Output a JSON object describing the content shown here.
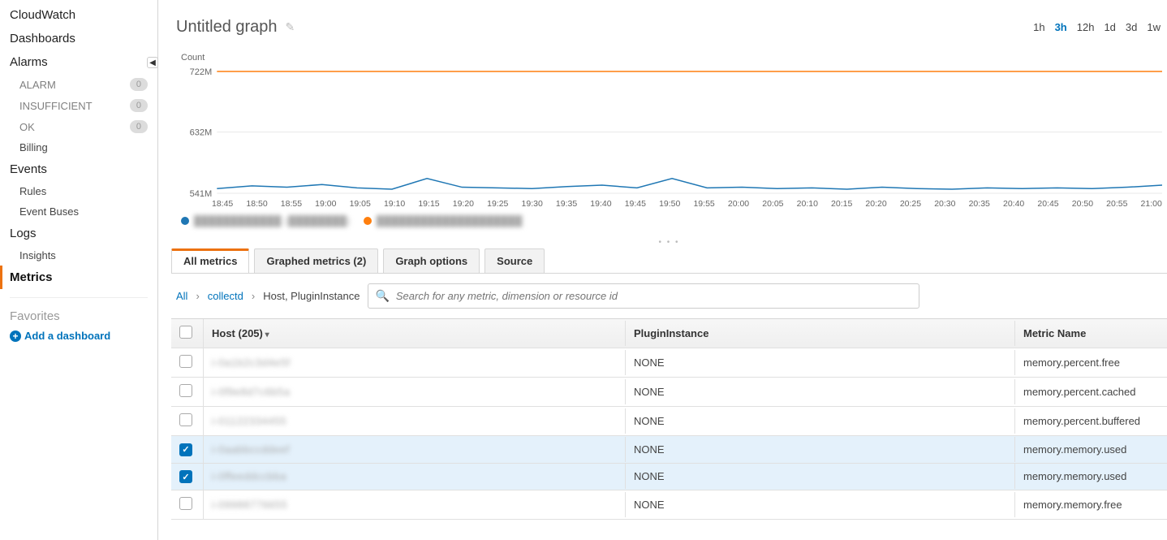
{
  "sidebar": {
    "items": [
      {
        "label": "CloudWatch",
        "type": "top"
      },
      {
        "label": "Dashboards",
        "type": "top"
      },
      {
        "label": "Alarms",
        "type": "top"
      },
      {
        "label": "ALARM",
        "type": "sub",
        "badge": "0",
        "muted": true
      },
      {
        "label": "INSUFFICIENT",
        "type": "sub",
        "badge": "0",
        "muted": true
      },
      {
        "label": "OK",
        "type": "sub",
        "badge": "0",
        "muted": true
      },
      {
        "label": "Billing",
        "type": "sub",
        "normal": true
      },
      {
        "label": "Events",
        "type": "top"
      },
      {
        "label": "Rules",
        "type": "sub",
        "normal": true
      },
      {
        "label": "Event Buses",
        "type": "sub",
        "normal": true
      },
      {
        "label": "Logs",
        "type": "top"
      },
      {
        "label": "Insights",
        "type": "sub",
        "normal": true
      },
      {
        "label": "Metrics",
        "type": "top",
        "active": true
      }
    ],
    "favorites_title": "Favorites",
    "add_dashboard": "Add a dashboard"
  },
  "header": {
    "title": "Untitled graph",
    "time_ranges": [
      "1h",
      "3h",
      "12h",
      "1d",
      "3d",
      "1w"
    ],
    "active_range": "3h"
  },
  "chart_data": {
    "type": "line",
    "title": "Count",
    "ylabel": "Count",
    "y_ticks": [
      "722M",
      "632M",
      "541M"
    ],
    "ylim": [
      541,
      722
    ],
    "x_ticks": [
      "18:45",
      "18:50",
      "18:55",
      "19:00",
      "19:05",
      "19:10",
      "19:15",
      "19:20",
      "19:25",
      "19:30",
      "19:35",
      "19:40",
      "19:45",
      "19:50",
      "19:55",
      "20:00",
      "20:05",
      "20:10",
      "20:15",
      "20:20",
      "20:25",
      "20:30",
      "20:35",
      "20:40",
      "20:45",
      "20:50",
      "20:55",
      "21:00"
    ],
    "series": [
      {
        "name": "series-a-redacted",
        "color": "#1f77b4",
        "values": [
          548,
          552,
          550,
          554,
          549,
          547,
          563,
          550,
          549,
          548,
          551,
          553,
          549,
          563,
          549,
          550,
          548,
          549,
          547,
          550,
          548,
          547,
          549,
          548,
          549,
          548,
          550,
          553
        ]
      },
      {
        "name": "series-b-redacted",
        "color": "#ff7f0e",
        "values": [
          722,
          722,
          722,
          722,
          722,
          722,
          722,
          722,
          722,
          722,
          722,
          722,
          722,
          722,
          722,
          722,
          722,
          722,
          722,
          722,
          722,
          722,
          722,
          722,
          722,
          722,
          722,
          722
        ]
      }
    ],
    "legend": [
      {
        "color": "#1f77b4",
        "label": "████████████ (████████)"
      },
      {
        "color": "#ff7f0e",
        "label": "████████████████████"
      }
    ]
  },
  "tabs": [
    {
      "label": "All metrics",
      "active": true
    },
    {
      "label": "Graphed metrics (2)"
    },
    {
      "label": "Graph options"
    },
    {
      "label": "Source"
    }
  ],
  "breadcrumbs": {
    "all": "All",
    "namespace": "collectd",
    "dim": "Host, PluginInstance"
  },
  "search": {
    "placeholder": "Search for any metric, dimension or resource id"
  },
  "table": {
    "cols": {
      "host": "Host",
      "host_count": "(205)",
      "plugin": "PluginInstance",
      "metric": "Metric Name"
    },
    "rows": [
      {
        "checked": false,
        "host": "i-0a1b2c3d4e5f",
        "plugin": "NONE",
        "metric": "memory.percent.free"
      },
      {
        "checked": false,
        "host": "i-0f9e8d7c6b5a",
        "plugin": "NONE",
        "metric": "memory.percent.cached"
      },
      {
        "checked": false,
        "host": "i-01122334455",
        "plugin": "NONE",
        "metric": "memory.percent.buffered"
      },
      {
        "checked": true,
        "host": "i-0aabbccddeef",
        "plugin": "NONE",
        "metric": "memory.memory.used"
      },
      {
        "checked": true,
        "host": "i-0ffeeddccbba",
        "plugin": "NONE",
        "metric": "memory.memory.used"
      },
      {
        "checked": false,
        "host": "i-09988776655",
        "plugin": "NONE",
        "metric": "memory.memory.free"
      }
    ]
  }
}
